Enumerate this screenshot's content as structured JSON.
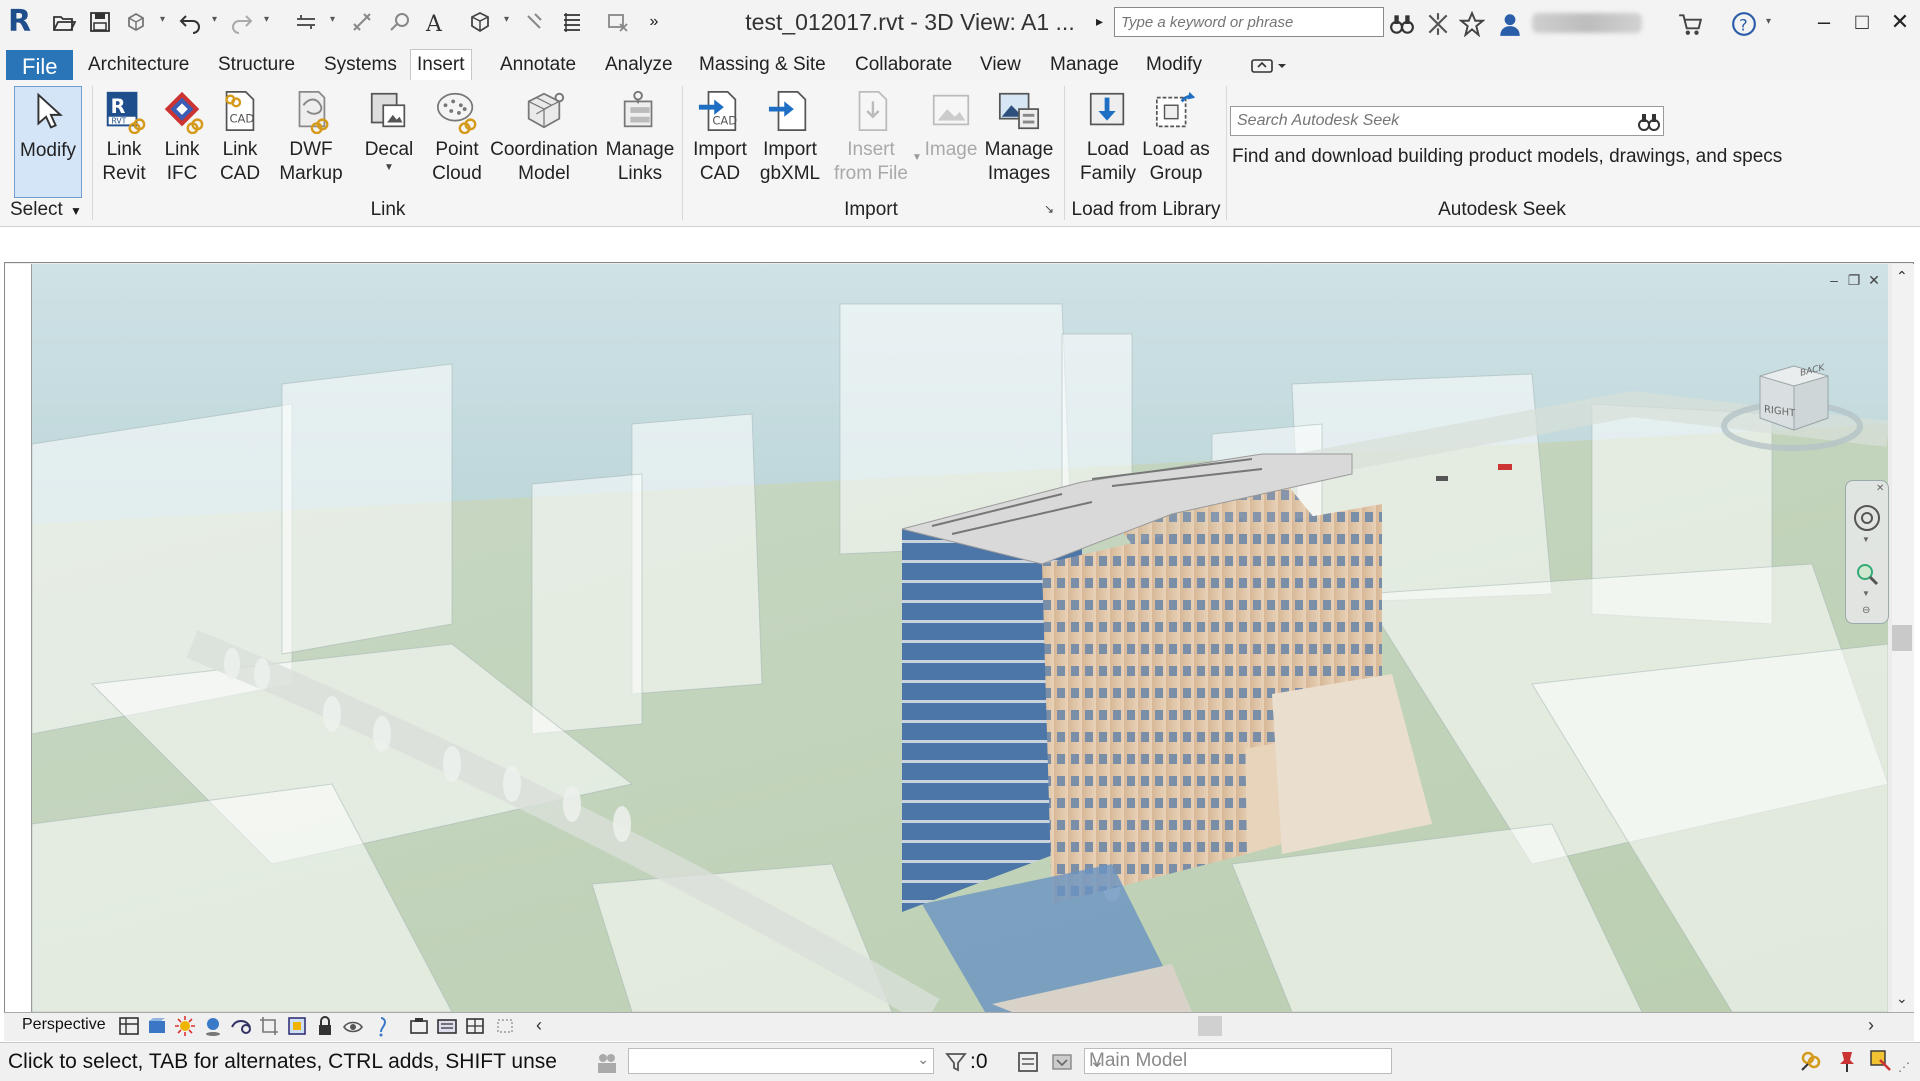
{
  "app": {
    "logo_letter": "R",
    "window_title": "test_012017.rvt - 3D View: A1 ...",
    "title_arrow": "▸"
  },
  "help_search": {
    "placeholder": "Type a keyword or phrase"
  },
  "window_controls": {
    "minimize": "–",
    "maximize": "□",
    "close": "✕"
  },
  "tabs": [
    {
      "label": "File"
    },
    {
      "label": "Architecture"
    },
    {
      "label": "Structure"
    },
    {
      "label": "Systems"
    },
    {
      "label": "Insert"
    },
    {
      "label": "Annotate"
    },
    {
      "label": "Analyze"
    },
    {
      "label": "Massing & Site"
    },
    {
      "label": "Collaborate"
    },
    {
      "label": "View"
    },
    {
      "label": "Manage"
    },
    {
      "label": "Modify"
    }
  ],
  "active_tab": "Insert",
  "ribbon": {
    "select": {
      "modify": "Modify",
      "panel": "Select"
    },
    "link": {
      "panel": "Link",
      "buttons": [
        {
          "label": "Link\nRevit"
        },
        {
          "label": "Link\nIFC"
        },
        {
          "label": "Link\nCAD"
        },
        {
          "label": "DWF\nMarkup"
        },
        {
          "label": "Decal"
        },
        {
          "label": "Point\nCloud"
        },
        {
          "label": "Coordination\nModel"
        },
        {
          "label": "Manage\nLinks"
        }
      ]
    },
    "import": {
      "panel": "Import",
      "buttons": [
        {
          "label": "Import\nCAD"
        },
        {
          "label": "Import\ngbXML"
        },
        {
          "label": "Insert\nfrom File"
        },
        {
          "label": "Image"
        },
        {
          "label": "Manage\nImages"
        }
      ]
    },
    "library": {
      "panel": "Load from Library",
      "buttons": [
        {
          "label": "Load\nFamily"
        },
        {
          "label": "Load as\nGroup"
        }
      ]
    },
    "seek": {
      "panel": "Autodesk Seek",
      "placeholder": "Search Autodesk Seek",
      "description": "Find and download building product models, drawings, and specs"
    }
  },
  "view_cube": {
    "right": "RIGHT",
    "back": "BACK"
  },
  "view_bar": {
    "scale_label": "Perspective"
  },
  "status": {
    "text": "Click to select, TAB for alternates, CTRL adds, SHIFT unse",
    "selection_count": ":0",
    "model": "Main Model"
  }
}
